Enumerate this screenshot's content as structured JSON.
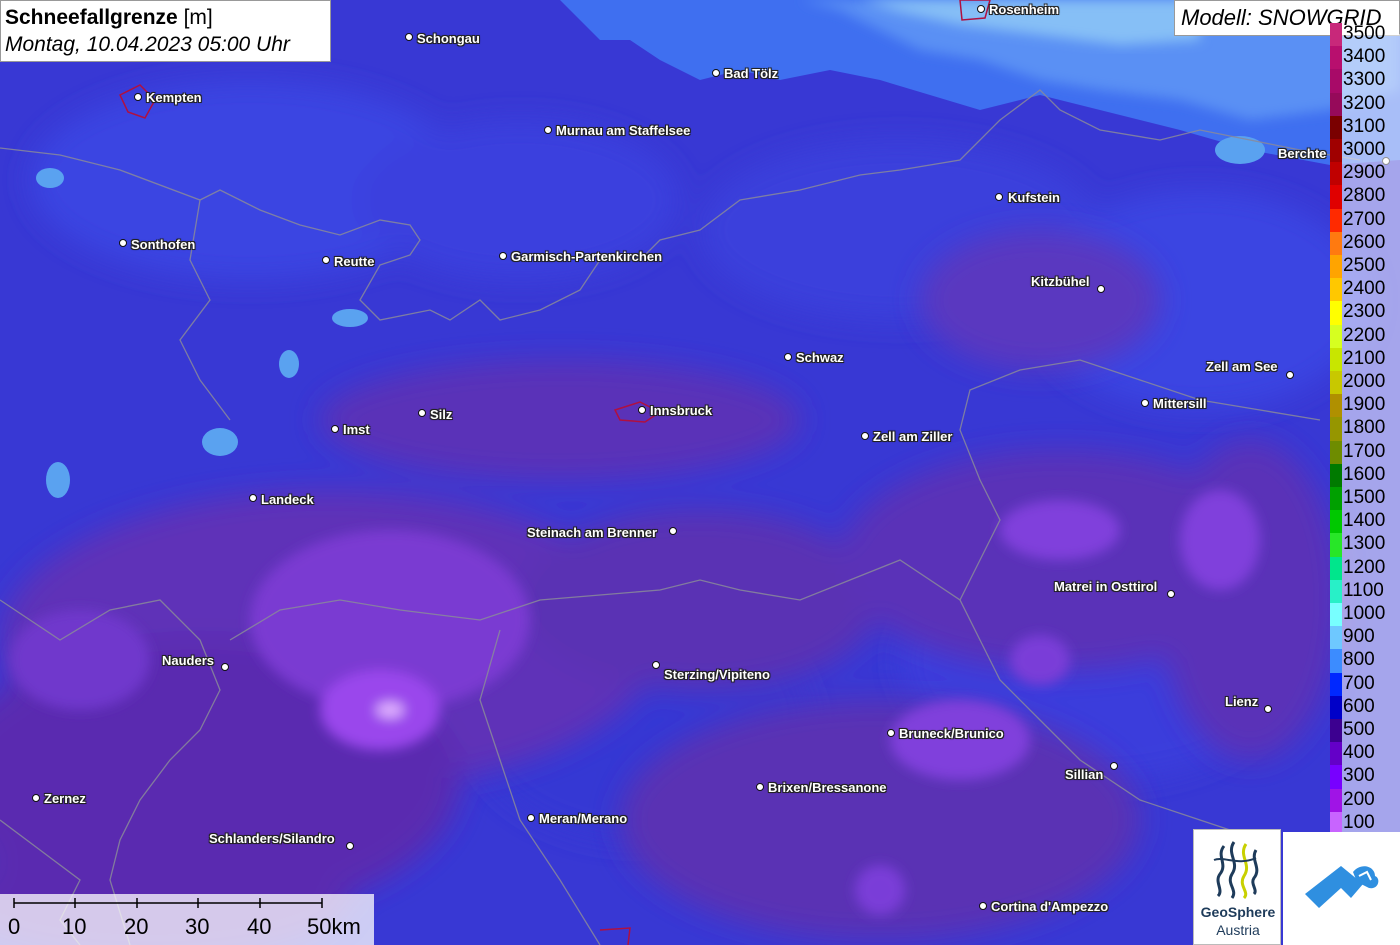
{
  "header": {
    "title": "Schneefallgrenze",
    "unit": "[m]",
    "datetime": "Montag, 10.04.2023 05:00 Uhr",
    "model": "Modell: SNOWGRID"
  },
  "cities": [
    {
      "name": "Rosenheim"
    },
    {
      "name": "Schongau"
    },
    {
      "name": "Bad Tölz"
    },
    {
      "name": "Kempten"
    },
    {
      "name": "Murnau am Staffelsee"
    },
    {
      "name": "Berchte"
    },
    {
      "name": "Kufstein"
    },
    {
      "name": "Sonthofen"
    },
    {
      "name": "Reutte"
    },
    {
      "name": "Garmisch-Partenkirchen"
    },
    {
      "name": "Kitzbühel"
    },
    {
      "name": "Schwaz"
    },
    {
      "name": "Zell am See"
    },
    {
      "name": "Mittersill"
    },
    {
      "name": "Silz"
    },
    {
      "name": "Innsbruck"
    },
    {
      "name": "Imst"
    },
    {
      "name": "Zell am Ziller"
    },
    {
      "name": "Landeck"
    },
    {
      "name": "Steinach am Brenner"
    },
    {
      "name": "Matrei in Osttirol"
    },
    {
      "name": "Nauders"
    },
    {
      "name": "Sterzing/Vipiteno"
    },
    {
      "name": "Lienz"
    },
    {
      "name": "Bruneck/Brunico"
    },
    {
      "name": "Sillian"
    },
    {
      "name": "Brixen/Bressanone"
    },
    {
      "name": "Zernez"
    },
    {
      "name": "Meran/Merano"
    },
    {
      "name": "Schlanders/Silandro"
    },
    {
      "name": "Cortina d'Ampezzo"
    }
  ],
  "legend": {
    "items": [
      {
        "label": "3500",
        "color": "#c8287a"
      },
      {
        "label": "3400",
        "color": "#b80f6e"
      },
      {
        "label": "3300",
        "color": "#a80a68"
      },
      {
        "label": "3200",
        "color": "#960a5a"
      },
      {
        "label": "3100",
        "color": "#7a0000"
      },
      {
        "label": "3000",
        "color": "#a00000"
      },
      {
        "label": "2900",
        "color": "#c00000"
      },
      {
        "label": "2800",
        "color": "#e00000"
      },
      {
        "label": "2700",
        "color": "#ff2a00"
      },
      {
        "label": "2600",
        "color": "#ff7a10"
      },
      {
        "label": "2500",
        "color": "#ffa400"
      },
      {
        "label": "2400",
        "color": "#ffc800"
      },
      {
        "label": "2300",
        "color": "#ffff00"
      },
      {
        "label": "2200",
        "color": "#d6ff20"
      },
      {
        "label": "2100",
        "color": "#c8e600"
      },
      {
        "label": "2000",
        "color": "#c8c800"
      },
      {
        "label": "1900",
        "color": "#b09000"
      },
      {
        "label": "1800",
        "color": "#969600"
      },
      {
        "label": "1700",
        "color": "#6e8c00"
      },
      {
        "label": "1600",
        "color": "#007a00"
      },
      {
        "label": "1500",
        "color": "#00a000"
      },
      {
        "label": "1400",
        "color": "#00c800"
      },
      {
        "label": "1300",
        "color": "#28e628"
      },
      {
        "label": "1200",
        "color": "#00e68c"
      },
      {
        "label": "1100",
        "color": "#28f0c8"
      },
      {
        "label": "1000",
        "color": "#78ffff"
      },
      {
        "label": "900",
        "color": "#6ec8ff"
      },
      {
        "label": "800",
        "color": "#3c8cff"
      },
      {
        "label": "700",
        "color": "#0028ff"
      },
      {
        "label": "600",
        "color": "#0000c8"
      },
      {
        "label": "500",
        "color": "#3c0090"
      },
      {
        "label": "400",
        "color": "#6400c8"
      },
      {
        "label": "300",
        "color": "#7800ff"
      },
      {
        "label": "200",
        "color": "#a014e6"
      },
      {
        "label": "100",
        "color": "#c864ff"
      }
    ]
  },
  "scalebar": {
    "labels": [
      "0",
      "10",
      "20",
      "30",
      "40",
      "50km"
    ]
  },
  "logos": {
    "geosphere_line1": "GeoSphere",
    "geosphere_line2": "Austria"
  }
}
